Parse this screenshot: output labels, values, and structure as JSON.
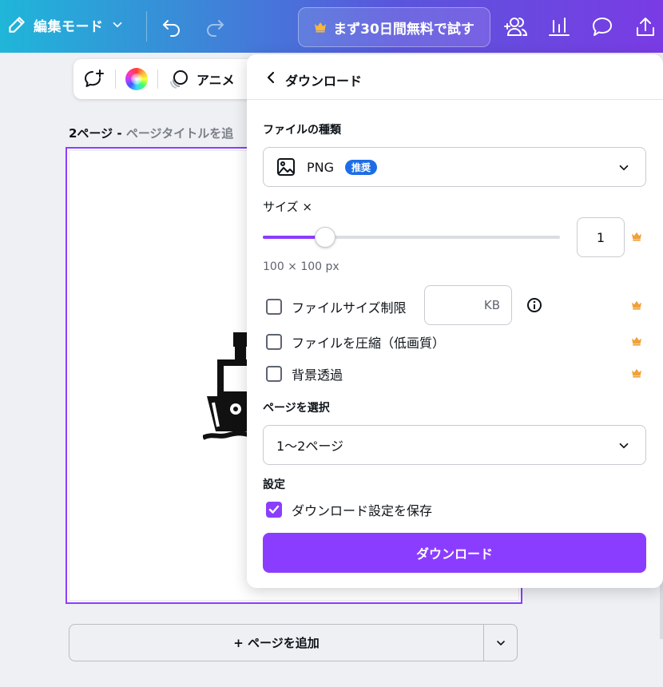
{
  "topbar": {
    "edit_mode_label": "編集モード",
    "trial_label": "まず30日間無料で試す",
    "icons": [
      "pencil-icon",
      "chevron-down-icon",
      "undo-icon",
      "redo-icon",
      "crown-icon",
      "share-people-icon",
      "analytics-icon",
      "comment-icon",
      "upload-icon"
    ]
  },
  "canvas_toolbar": {
    "animate_label": "アニメ"
  },
  "page": {
    "number_label": "2ページ - ",
    "title_placeholder": "ページタイトルを追"
  },
  "add_page": {
    "label": "+ ページを追加"
  },
  "download_panel": {
    "title": "ダウンロード",
    "file_type_label": "ファイルの種類",
    "file_type_value": "PNG",
    "recommended_badge": "推奨",
    "size_label": "サイズ ×",
    "size_value": "1",
    "size_slider_fraction": 0.21,
    "dimensions": "100 × 100 px",
    "options": [
      {
        "label": "ファイルサイズ制限",
        "checked": false
      },
      {
        "label": "ファイルを圧縮（低画質）",
        "checked": false
      },
      {
        "label": "背景透過",
        "checked": false
      }
    ],
    "kb_placeholder": "KB",
    "pages_label": "ページを選択",
    "pages_value": "1〜2ページ",
    "settings_label": "設定",
    "save_settings_label": "ダウンロード設定を保存",
    "save_settings_checked": true,
    "download_button": "ダウンロード"
  },
  "colors": {
    "accent": "#8b3dff",
    "badge": "#1d6de6",
    "crown": "#f0a13a"
  }
}
